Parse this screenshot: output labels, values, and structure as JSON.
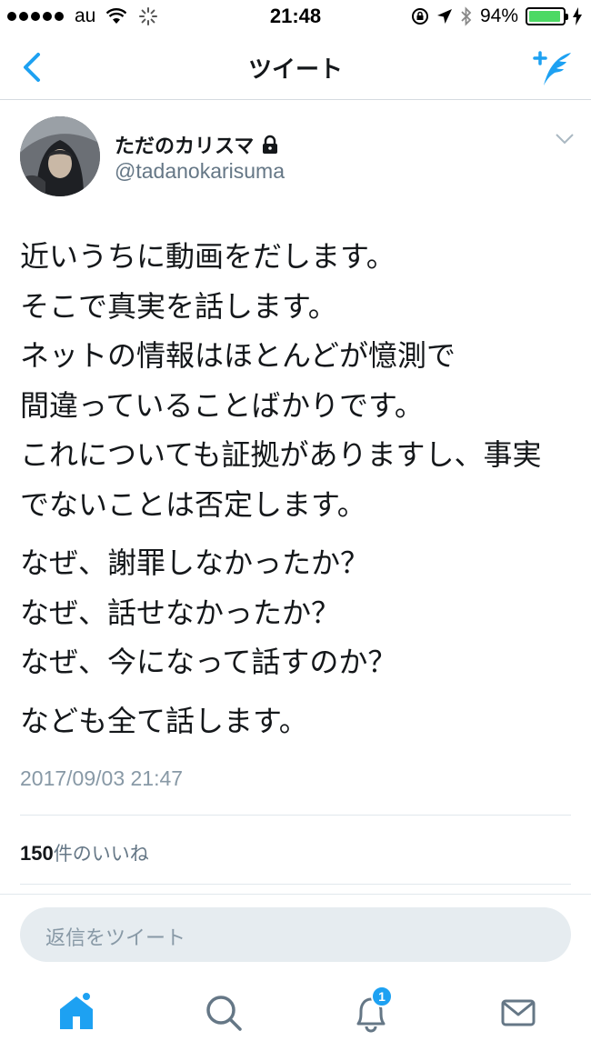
{
  "status_bar": {
    "carrier": "au",
    "time": "21:48",
    "battery_percent": "94%",
    "battery_level": 0.94
  },
  "nav": {
    "title": "ツイート",
    "back_icon": "chevron-left-icon",
    "compose_icon": "compose-tweet-icon"
  },
  "tweet": {
    "display_name": "ただのカリスマ",
    "handle": "@tadanokarisuma",
    "paragraphs": [
      [
        "近いうちに動画をだします。",
        "そこで真実を話します。",
        "ネットの情報はほとんどが憶測で",
        "間違っていることばかりです。",
        "これについても証拠がありますし、事実でないことは否定します。"
      ],
      [
        "なぜ、謝罪しなかったか？",
        "なぜ、話せなかったか？",
        "なぜ、今になって話すのか？"
      ],
      [
        "なども全て話します。"
      ]
    ],
    "timestamp": "2017/09/03 21:47",
    "likes_count": "150",
    "likes_label": "件のいいね"
  },
  "reply": {
    "placeholder": "返信をツイート"
  },
  "tabbar": {
    "notification_badge": "1"
  },
  "colors": {
    "accent": "#1da1f2",
    "text": "#14171a",
    "muted": "#8899a6"
  }
}
